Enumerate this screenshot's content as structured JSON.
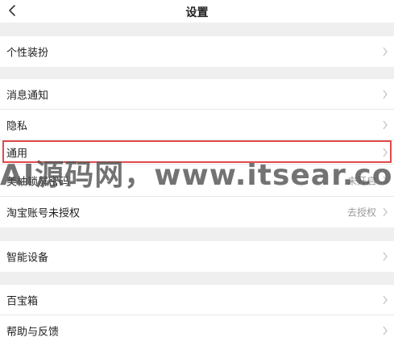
{
  "header": {
    "title": "设置"
  },
  "groups": [
    {
      "items": [
        {
          "label": "个性装扮"
        }
      ]
    },
    {
      "items": [
        {
          "label": "消息通知"
        },
        {
          "label": "隐私"
        },
        {
          "label": "通用"
        },
        {
          "label": "美柚锁屏密码",
          "value": "未开启"
        },
        {
          "label": "淘宝账号未授权",
          "value": "去授权"
        }
      ]
    },
    {
      "items": [
        {
          "label": "智能设备"
        }
      ]
    },
    {
      "items": [
        {
          "label": "百宝箱"
        },
        {
          "label": "帮助与反馈"
        }
      ]
    }
  ],
  "watermark": "AI源码网，www.itsear.com",
  "colors": {
    "highlight": "#e04a4a",
    "background": "#efefef"
  }
}
